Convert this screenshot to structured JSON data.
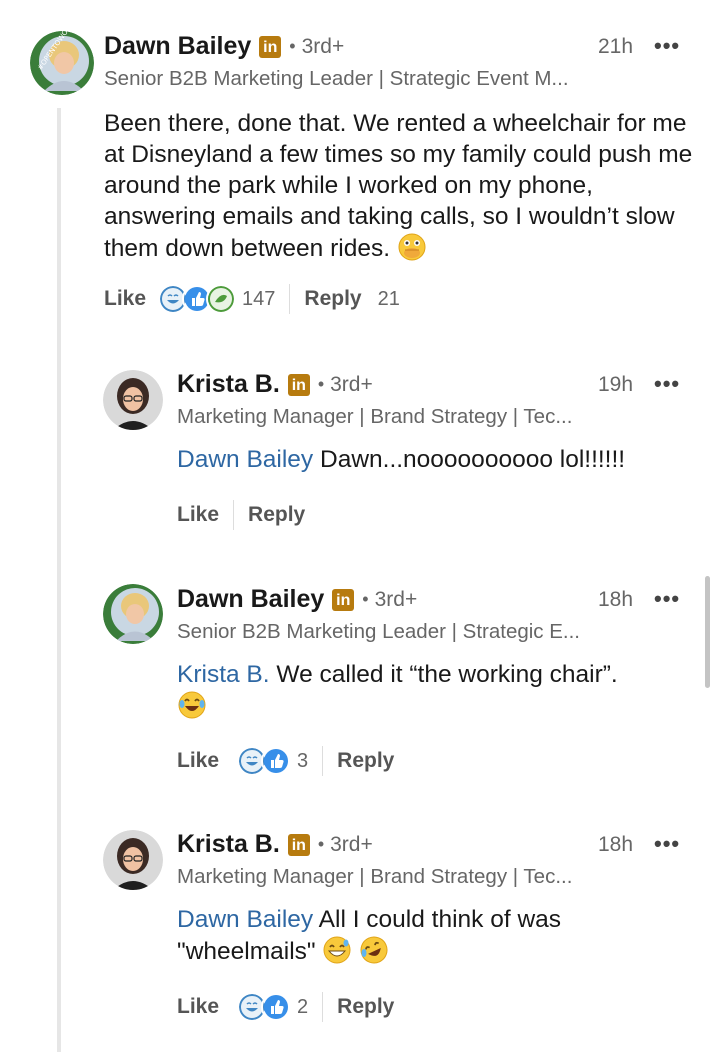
{
  "comments": [
    {
      "name": "Dawn Bailey",
      "badge": "in",
      "degree": "3rd+",
      "time": "21h",
      "more": "•••",
      "headline": "Senior B2B Marketing Leader | Strategic Event M...",
      "text": "Been there, done that. We rented a wheelchair for me at Disneyland a few times so my family could push me around the park while I worked on my phone, answering emails and taking calls, so I wouldn’t slow them down between rides.",
      "emoji": [
        "face-with-open-eyes-and-hand-over-mouth"
      ],
      "like_label": "Like",
      "reply_label": "Reply",
      "reaction_count": "147",
      "reply_count": "21",
      "reactions": [
        "funny",
        "like",
        "support"
      ]
    },
    {
      "name": "Krista B.",
      "badge": "in",
      "degree": "3rd+",
      "time": "19h",
      "more": "•••",
      "headline": "Marketing Manager | Brand Strategy | Tec...",
      "mention": "Dawn Bailey",
      "text": "Dawn...noooooooooo lol!!!!!!",
      "like_label": "Like",
      "reply_label": "Reply"
    },
    {
      "name": "Dawn Bailey",
      "badge": "in",
      "degree": "3rd+",
      "time": "18h",
      "more": "•••",
      "headline": "Senior B2B Marketing Leader | Strategic E...",
      "mention": "Krista B.",
      "text": "We called it “the working chair”.",
      "emoji": [
        "face-with-tears-of-joy"
      ],
      "like_label": "Like",
      "reply_label": "Reply",
      "reaction_count": "3",
      "reactions": [
        "funny",
        "like"
      ]
    },
    {
      "name": "Krista B.",
      "badge": "in",
      "degree": "3rd+",
      "time": "18h",
      "more": "•••",
      "headline": "Marketing Manager | Brand Strategy | Tec...",
      "mention": "Dawn Bailey",
      "text": "All I could think of was \"wheelmails\"",
      "emoji": [
        "grinning-face-with-sweat",
        "rolling-on-the-floor-laughing"
      ],
      "like_label": "Like",
      "reply_label": "Reply",
      "reaction_count": "2",
      "reactions": [
        "funny",
        "like"
      ]
    }
  ],
  "dot": "•",
  "opentowork_ring": "#OPENTOWORK",
  "colors": {
    "mention": "#2e67a3",
    "badge": "#b77b0f",
    "ring": "#3a7d3a"
  }
}
